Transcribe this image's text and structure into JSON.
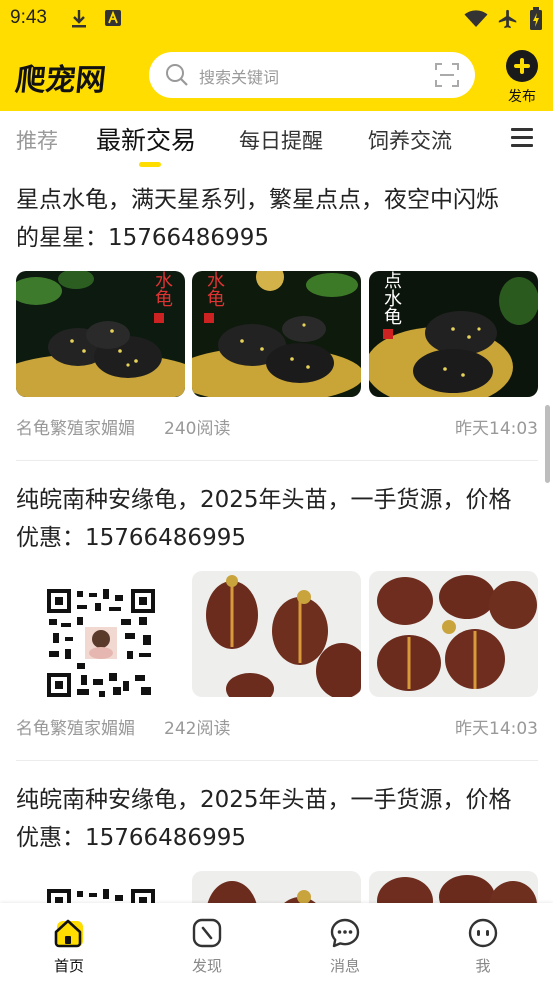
{
  "status_bar": {
    "time": "9:43"
  },
  "header": {
    "logo": "爬宠网",
    "search_placeholder": "搜索关键词",
    "publish_label": "发布"
  },
  "tabs": [
    {
      "label": "推荐"
    },
    {
      "label": "最新交易",
      "active": true
    },
    {
      "label": "每日提醒"
    },
    {
      "label": "饲养交流"
    }
  ],
  "posts": [
    {
      "title_line1": "星点水龟，满天星系列，繁星点点，夜空中闪烁",
      "title_line2": "的星星：15766486995",
      "images": [
        {
          "caption": "水龟",
          "icon": "turtle-photo"
        },
        {
          "caption": "水龟",
          "icon": "turtle-photo"
        },
        {
          "caption": "点水龟",
          "icon": "turtle-photo"
        }
      ],
      "author": "名龟繁殖家媚媚",
      "reads": "240阅读",
      "time": "昨天14:03"
    },
    {
      "title_line1": "纯皖南种安缘龟，2025年头苗，一手货源，价格",
      "title_line2": "优惠：15766486995",
      "images": [
        {
          "icon": "qr-code"
        },
        {
          "icon": "turtle-photo"
        },
        {
          "icon": "turtle-photo"
        }
      ],
      "author": "名龟繁殖家媚媚",
      "reads": "242阅读",
      "time": "昨天14:03"
    },
    {
      "title_line1": "纯皖南种安缘龟，2025年头苗，一手货源，价格",
      "title_line2": "优惠：15766486995",
      "images": [
        {
          "icon": "qr-code"
        },
        {
          "icon": "turtle-photo"
        },
        {
          "icon": "turtle-photo"
        }
      ]
    }
  ],
  "bottom_nav": [
    {
      "label": "首页",
      "icon": "home-icon",
      "active": true
    },
    {
      "label": "发现",
      "icon": "compass-icon"
    },
    {
      "label": "消息",
      "icon": "chat-icon"
    },
    {
      "label": "我",
      "icon": "profile-icon"
    }
  ],
  "colors": {
    "brand": "#ffdd00",
    "text": "#222222",
    "muted": "#999999"
  }
}
